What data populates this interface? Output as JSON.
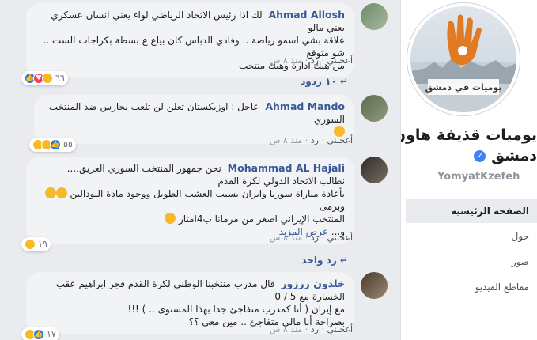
{
  "comments": [
    {
      "author": "Ahmad Allosh",
      "text": "لك اذا رئيس الاتحاد الرياضي لواء يعني انسان عسكري يعني مالو\nعلاقة بشي اسمو رياضة .. وفادي الدباس كان بياع ع بسطة بكراجات الست .. شو متوقع\nمن هيك ادارة وهيك منتخب",
      "reaction_count": "٦٦",
      "like": "أعجبني",
      "reply": "رد",
      "time": "منذ ٨ س",
      "replies": "١٠ ردود"
    },
    {
      "author": "Ahmad Mando",
      "text": "عاجل : اوزبكستان تعلن لن تلعب بحارس ضد المنتخب السوري",
      "reaction_count": "٥٥",
      "like": "أعجبني",
      "reply": "رد",
      "time": "منذ ٨ س"
    },
    {
      "author": "Mohammad AL Hajali",
      "line1": "نحن جمهور المنتخب السوري العريق....",
      "line2": "نطالب الاتحاد الدولي لكرة القدم",
      "line3": "بأعادة مباراة سوريا وايران بسبب العشب الطويل ووجود مادة النودالين",
      "line3b": "وبرمى",
      "line4": "المنتخب الإيراني اصغر من مرمانا ب4امتار",
      "line5": "و... ",
      "see_more": "عرض المزيد",
      "reaction_count": "١٩",
      "like": "أعجبني",
      "reply": "رد",
      "time": "منذ ٨ س",
      "replies": "رد واحد"
    },
    {
      "author": "خلدون زرزور",
      "text": "قال مدرب منتخبنا الوطني لكرة القدم فجر ابراهيم عقب الخسارة مع 5 / 0\nمع إيران ( أنا كمدرب متفاجئ جدا بهذا المستوى .. ) !!!\nبصراحة أنا مالي متفاجئ .. مين معي ؟؟",
      "reaction_count": "١٧",
      "like": "أعجبني",
      "reply": "رد",
      "time": "منذ ٨ س"
    }
  ],
  "sidebar": {
    "logo_text": "يوميات في دمشق",
    "page_name_line1": "يوميات قذيفة هاون في",
    "page_name_line2": "دمشق",
    "username": "YomyatKzefeh",
    "nav": [
      "الصفحة الرئيسية",
      "حول",
      "صور",
      "مقاطع الفيديو"
    ]
  },
  "colors": {
    "link": "#385898",
    "accent": "#1877f2",
    "logo_orange": "#e07b24"
  }
}
